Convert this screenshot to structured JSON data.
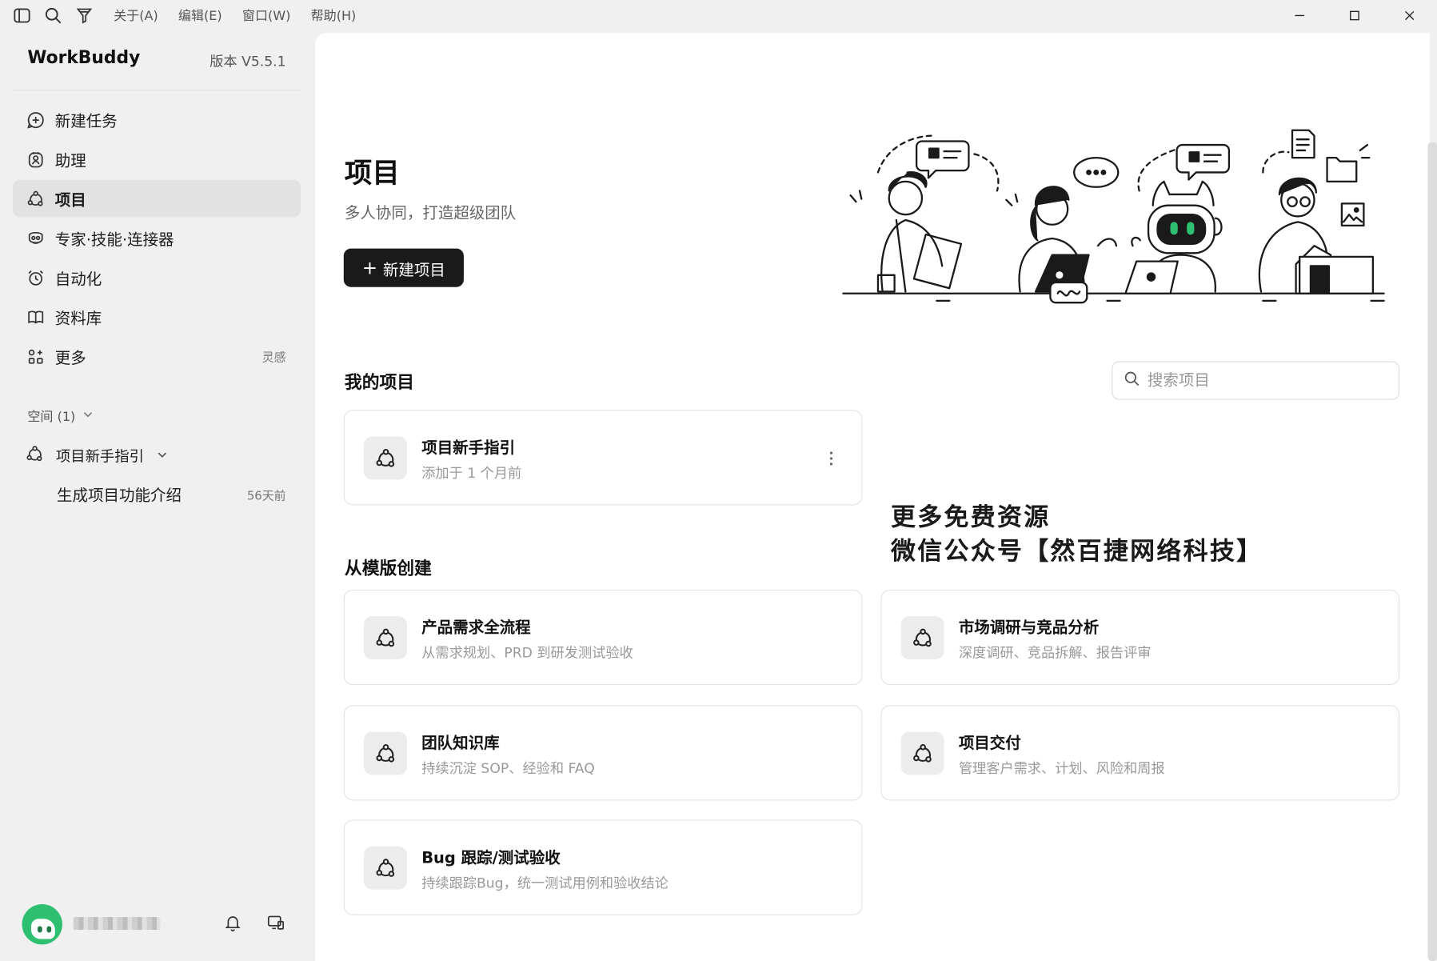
{
  "menubar": {
    "items": [
      "关于(A)",
      "编辑(E)",
      "窗口(W)",
      "帮助(H)"
    ]
  },
  "sidebar": {
    "brand": "WorkBuddy",
    "version": "版本 V5.5.1",
    "nav": [
      {
        "label": "新建任务",
        "icon": "plus-circle-icon"
      },
      {
        "label": "助理",
        "icon": "assistant-icon"
      },
      {
        "label": "项目",
        "icon": "project-icon",
        "active": true
      },
      {
        "label": "专家·技能·连接器",
        "icon": "expert-icon"
      },
      {
        "label": "自动化",
        "icon": "alarm-icon"
      },
      {
        "label": "资料库",
        "icon": "book-icon"
      },
      {
        "label": "更多",
        "icon": "apps-icon",
        "badge": "灵感"
      }
    ],
    "space": {
      "header": "空间 (1)",
      "project": "项目新手指引",
      "task": "生成项目功能介绍",
      "task_time": "56天前"
    }
  },
  "main": {
    "title": "项目",
    "subtitle": "多人协同，打造超级团队",
    "new_project_label": "新建项目",
    "my_projects_title": "我的项目",
    "search_placeholder": "搜索项目",
    "my_projects": [
      {
        "title": "项目新手指引",
        "desc": "添加于 1 个月前"
      }
    ],
    "templates_title": "从模版创建",
    "templates": [
      {
        "title": "产品需求全流程",
        "desc": "从需求规划、PRD 到研发测试验收"
      },
      {
        "title": "市场调研与竞品分析",
        "desc": "深度调研、竞品拆解、报告评审"
      },
      {
        "title": "团队知识库",
        "desc": "持续沉淀 SOP、经验和 FAQ"
      },
      {
        "title": "项目交付",
        "desc": "管理客户需求、计划、风险和周报"
      },
      {
        "title": "Bug 跟踪/测试验收",
        "desc": "持续跟踪Bug，统一测试用例和验收结论"
      }
    ],
    "watermark_line1": "更多免费资源",
    "watermark_line2": "微信公众号【然百捷网络科技】"
  }
}
